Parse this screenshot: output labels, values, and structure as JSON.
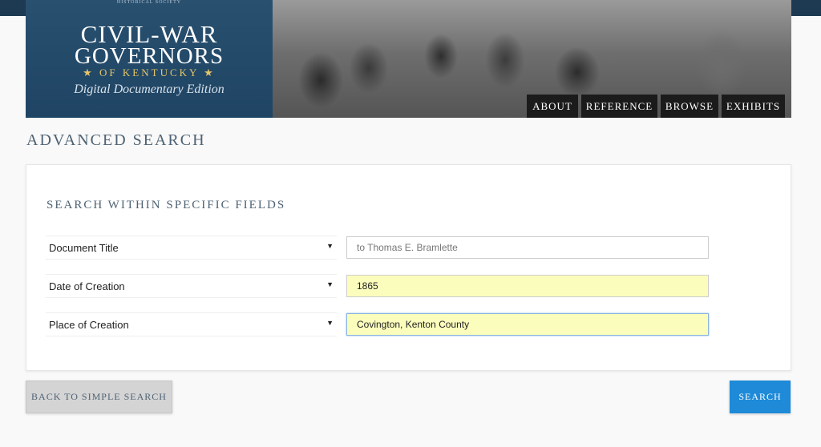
{
  "header": {
    "society_text": "HISTORICAL SOCIETY",
    "logo_line1": "CIVIL-WAR",
    "logo_line2": "GOVERNORS",
    "logo_line3": "★ OF KENTUCKY ★",
    "logo_line4": "Digital Documentary Edition"
  },
  "nav": {
    "items": [
      {
        "label": "ABOUT"
      },
      {
        "label": "REFERENCE"
      },
      {
        "label": "BROWSE"
      },
      {
        "label": "EXHIBITS"
      }
    ]
  },
  "page": {
    "title": "ADVANCED SEARCH",
    "section_title": "SEARCH WITHIN SPECIFIC FIELDS"
  },
  "rows": [
    {
      "field_label": "Document Title",
      "placeholder": "to Thomas E. Bramlette",
      "value": ""
    },
    {
      "field_label": "Date of Creation",
      "placeholder": "",
      "value": "1865"
    },
    {
      "field_label": "Place of Creation",
      "placeholder": "",
      "value": "Covington, Kenton County"
    }
  ],
  "buttons": {
    "back_label": "BACK TO SIMPLE SEARCH",
    "search_label": "SEARCH"
  },
  "colors": {
    "header_bar": "#1d3a52",
    "accent": "#1e8ad8",
    "filled_field": "#fbfdbc",
    "title_text": "#4e6273"
  },
  "icons": {
    "select_caret": "triangle-down-icon"
  }
}
